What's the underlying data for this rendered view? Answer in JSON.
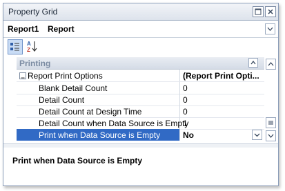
{
  "window": {
    "title": "Property Grid"
  },
  "selector": {
    "object_name": "Report1",
    "object_type": "Report"
  },
  "toolbar": {
    "categorized_tooltip": "Categorized",
    "alphabetical_tooltip": "Alphabetical"
  },
  "category": {
    "title": "Printing"
  },
  "rows": [
    {
      "label": "Report Print Options",
      "value": "(Report Print Opti...",
      "expandable": true
    },
    {
      "label": "Blank Detail Count",
      "value": "0"
    },
    {
      "label": "Detail Count",
      "value": "0"
    },
    {
      "label": "Detail Count at Design Time",
      "value": "0"
    },
    {
      "label": "Detail Count when Data Source is Empty",
      "value": "1"
    },
    {
      "label": "Print when Data Source is Empty",
      "value": "No",
      "selected": true
    }
  ],
  "description": {
    "text": "Print when Data Source is Empty"
  },
  "colors": {
    "selection": "#316ac5",
    "border": "#8a9cb8"
  }
}
